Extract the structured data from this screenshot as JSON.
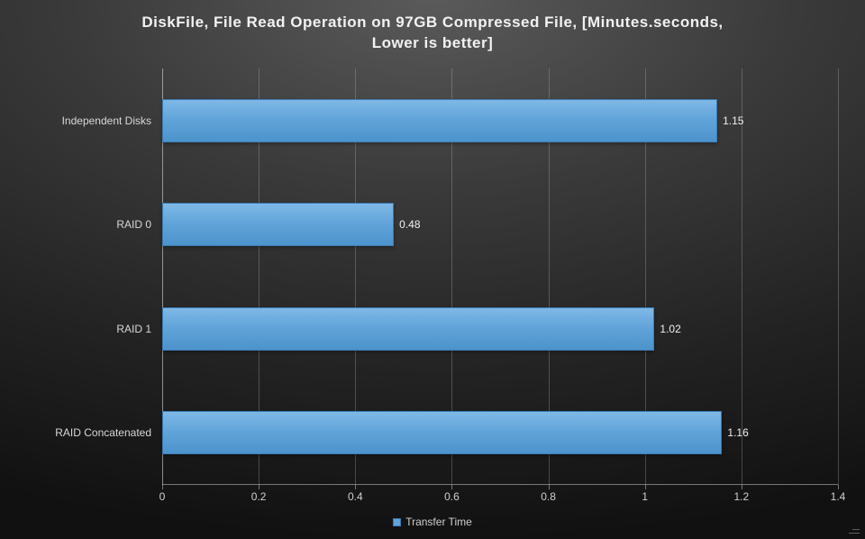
{
  "chart_data": {
    "type": "bar",
    "orientation": "horizontal",
    "title_line1": "DiskFile, File Read Operation on 97GB Compressed File, [Minutes.seconds,",
    "title_line2": "Lower is better]",
    "categories": [
      "Independent Disks",
      "RAID 0",
      "RAID 1",
      "RAID Concatenated"
    ],
    "values": [
      1.15,
      0.48,
      1.02,
      1.16
    ],
    "value_labels": [
      "1.15",
      "0.48",
      "1.02",
      "1.16"
    ],
    "series_name": "Transfer Time",
    "xlim": [
      0,
      1.4
    ],
    "xticks": [
      0,
      0.2,
      0.4,
      0.6,
      0.8,
      1,
      1.2,
      1.4
    ],
    "xtick_labels": [
      "0",
      "0.2",
      "0.4",
      "0.6",
      "0.8",
      "1",
      "1.2",
      "1.4"
    ],
    "xlabel": "",
    "ylabel": "",
    "legend_position": "bottom",
    "bar_color": "#5fa3d9"
  }
}
